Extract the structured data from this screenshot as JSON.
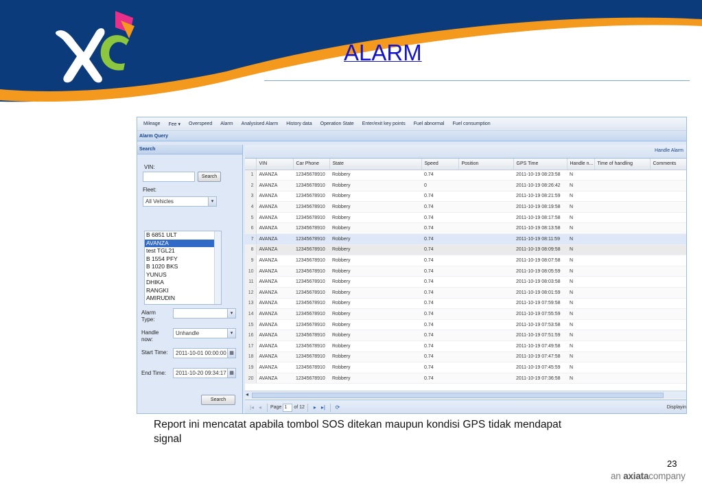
{
  "slide": {
    "title": "ALARM",
    "caption": "Report ini mencatat apabila tombol SOS ditekan maupun kondisi GPS tidak mendapat signal",
    "page_number": "23",
    "brand_prefix": "an",
    "brand_name": "axiata",
    "brand_suffix": "company",
    "colors": {
      "title": "#1414c8",
      "header_blue": "#0b3b7a",
      "header_orange": "#f39a1e"
    }
  },
  "app": {
    "menu": [
      "Mileage",
      "Fee ▾",
      "Overspeed",
      "Alarm",
      "Analysised Alarm",
      "History data",
      "Operation State",
      "Enter/exit key points",
      "Fuel abnormal",
      "Fuel consumption"
    ],
    "panel_title": "Alarm Query",
    "search_panel": {
      "title": "Search",
      "vin_label": "VIN:",
      "vin_value": "",
      "search_button": "Search",
      "fleet_label": "Fleet:",
      "fleet_value": "All Vehicles",
      "fleet_items": [
        "B 6851 ULT",
        "AVANZA",
        "test TGL21",
        "B 1554 PFY",
        "B 1020 BKS",
        "YUNUS",
        "DHIKA",
        "RANGKI",
        "AMIRUDIN"
      ],
      "fleet_selected": "AVANZA",
      "alarm_type_label": "Alarm Type:",
      "alarm_type_value": "",
      "handle_now_label": "Handle now:",
      "handle_now_value": "Unhandle",
      "start_time_label": "Start Time:",
      "start_time_value": "2011-10-01 00:00:00",
      "end_time_label": "End Time:",
      "end_time_value": "2011-10-20 09:34:17",
      "bottom_search_button": "Search"
    },
    "grid": {
      "toolbar_action": "Handle Alarm",
      "columns": [
        "",
        "VIN",
        "Car Phone",
        "State",
        "Speed",
        "Position",
        "GPS Time",
        "Handle n...",
        "Time of handling",
        "Comments"
      ],
      "rows": [
        [
          "1",
          "AVANZA",
          "12345678910",
          "Robbery",
          "0.74",
          "",
          "2011-10-19 08:23:58",
          "N",
          "",
          ""
        ],
        [
          "2",
          "AVANZA",
          "12345678910",
          "Robbery",
          "0",
          "",
          "2011-10-19 08:26:42",
          "N",
          "",
          ""
        ],
        [
          "3",
          "AVANZA",
          "12345678910",
          "Robbery",
          "0.74",
          "",
          "2011-10-19 08:21:59",
          "N",
          "",
          ""
        ],
        [
          "4",
          "AVANZA",
          "12345678910",
          "Robbery",
          "0.74",
          "",
          "2011-10-19 08:19:58",
          "N",
          "",
          ""
        ],
        [
          "5",
          "AVANZA",
          "12345678910",
          "Robbery",
          "0.74",
          "",
          "2011-10-19 08:17:58",
          "N",
          "",
          ""
        ],
        [
          "6",
          "AVANZA",
          "12345678910",
          "Robbery",
          "0.74",
          "",
          "2011-10-19 08:13:58",
          "N",
          "",
          ""
        ],
        [
          "7",
          "AVANZA",
          "12345678910",
          "Robbery",
          "0.74",
          "",
          "2011-10-19 08:11:59",
          "N",
          "",
          ""
        ],
        [
          "8",
          "AVANZA",
          "12345678910",
          "Robbery",
          "0.74",
          "",
          "2011-10-19 08:09:58",
          "N",
          "",
          ""
        ],
        [
          "9",
          "AVANZA",
          "12345678910",
          "Robbery",
          "0.74",
          "",
          "2011-10-19 08:07:58",
          "N",
          "",
          ""
        ],
        [
          "10",
          "AVANZA",
          "12345678910",
          "Robbery",
          "0.74",
          "",
          "2011-10-19 08:05:59",
          "N",
          "",
          ""
        ],
        [
          "11",
          "AVANZA",
          "12345678910",
          "Robbery",
          "0.74",
          "",
          "2011-10-19 08:03:58",
          "N",
          "",
          ""
        ],
        [
          "12",
          "AVANZA",
          "12345678910",
          "Robbery",
          "0.74",
          "",
          "2011-10-19 08:01:59",
          "N",
          "",
          ""
        ],
        [
          "13",
          "AVANZA",
          "12345678910",
          "Robbery",
          "0.74",
          "",
          "2011-10-19 07:59:58",
          "N",
          "",
          ""
        ],
        [
          "14",
          "AVANZA",
          "12345678910",
          "Robbery",
          "0.74",
          "",
          "2011-10-19 07:55:59",
          "N",
          "",
          ""
        ],
        [
          "15",
          "AVANZA",
          "12345678910",
          "Robbery",
          "0.74",
          "",
          "2011-10-19 07:53:58",
          "N",
          "",
          ""
        ],
        [
          "16",
          "AVANZA",
          "12345678910",
          "Robbery",
          "0.74",
          "",
          "2011-10-19 07:51:59",
          "N",
          "",
          ""
        ],
        [
          "17",
          "AVANZA",
          "12345678910",
          "Robbery",
          "0.74",
          "",
          "2011-10-19 07:49:58",
          "N",
          "",
          ""
        ],
        [
          "18",
          "AVANZA",
          "12345678910",
          "Robbery",
          "0.74",
          "",
          "2011-10-19 07:47:58",
          "N",
          "",
          ""
        ],
        [
          "19",
          "AVANZA",
          "12345678910",
          "Robbery",
          "0.74",
          "",
          "2011-10-19 07:45:59",
          "N",
          "",
          ""
        ],
        [
          "20",
          "AVANZA",
          "12345678910",
          "Robbery",
          "0.74",
          "",
          "2011-10-19 07:36:58",
          "N",
          "",
          ""
        ]
      ],
      "highlighted_rows": [
        7,
        8
      ],
      "pager": {
        "page_label": "Page",
        "page_value": "1",
        "of_label": "of 12",
        "displaying": "Displayin"
      }
    }
  }
}
